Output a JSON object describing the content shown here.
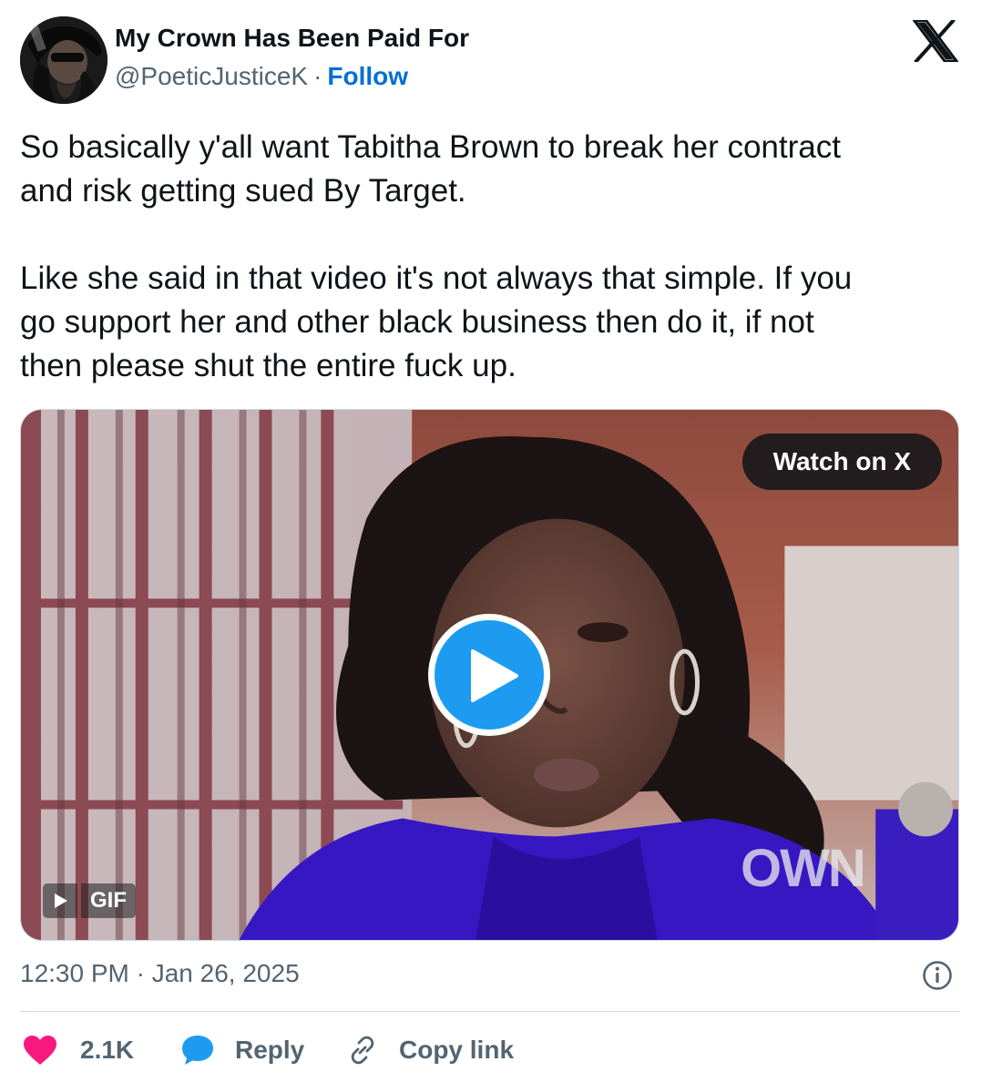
{
  "author": {
    "display_name": "My Crown Has Been Paid For",
    "handle": "@PoeticJusticeK",
    "separator": "·",
    "follow_label": "Follow"
  },
  "tweet": {
    "lines_paragraph_1": [
      "So basically y'all want Tabitha Brown to break her contract",
      "and risk getting sued By Target."
    ],
    "lines_paragraph_2": [
      "Like she said in that video it's not always that simple. If you",
      "go support her and other black business then do it, if not",
      "then please shut the entire fuck up."
    ]
  },
  "media": {
    "watch_label": "Watch on X",
    "gif_label": "GIF",
    "watermark": "OWN"
  },
  "meta": {
    "timestamp": "12:30 PM · Jan 26, 2025"
  },
  "actions": {
    "like_count": "2.1K",
    "reply_label": "Reply",
    "copy_label": "Copy link"
  },
  "colors": {
    "follow": "#006fd6",
    "like": "#f91880",
    "reply_icon": "#1d9bf0",
    "play_button": "#1d9bf0",
    "secondary_text": "#536471"
  },
  "icons": {
    "brand": "x-logo-icon",
    "info": "info-icon",
    "like": "heart-icon",
    "reply": "speech-bubble-icon",
    "copy": "link-icon",
    "play": "play-icon"
  }
}
